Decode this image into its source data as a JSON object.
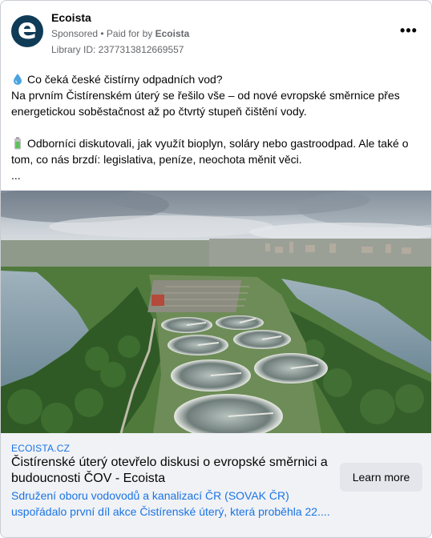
{
  "header": {
    "avatar_letter": "e",
    "page_name": "Ecoista",
    "sponsored": "Sponsored",
    "separator": " • ",
    "paid_for_by_prefix": "Paid for by ",
    "paid_for_by_name": "Ecoista",
    "library_id": "Library ID: 2377313812669557",
    "more_icon": "more-horizontal-icon"
  },
  "post": {
    "line1_icon": "droplet-icon",
    "line1": "Co čeká české čistírny odpadních vod?",
    "line2": "Na prvním Čistírenském úterý se řešilo vše – od nové evropské směrnice přes energetickou soběstačnost až po čtvrtý stupeň čištění vody.",
    "line3_icon": "battery-icon",
    "line3": "Odborníci diskutovali, jak využít bioplyn, soláry nebo gastroodpad. Ale také o tom, co nás brzdí: legislativa, peníze, neochota měnit věci.",
    "ellipsis": "..."
  },
  "image": {
    "alt": "Aerial view of a wastewater treatment plant beside a river"
  },
  "link": {
    "domain": "ECOISTA.CZ",
    "headline": "Čistírenské úterý otevřelo diskusi o evropské směrnici a budoucnosti ČOV - Ecoista",
    "description": "Sdružení oboru vodovodů a kanalizací ČR (SOVAK ČR) uspořádalo první díl akce Čistírenské úterý, která proběhla 22....",
    "cta": "Learn more"
  },
  "colors": {
    "link_blue": "#1b74e4",
    "muted_gray": "#65676b",
    "footer_bg": "#f0f2f5",
    "button_bg": "#e4e6eb",
    "avatar_bg": "#0f3b57"
  }
}
